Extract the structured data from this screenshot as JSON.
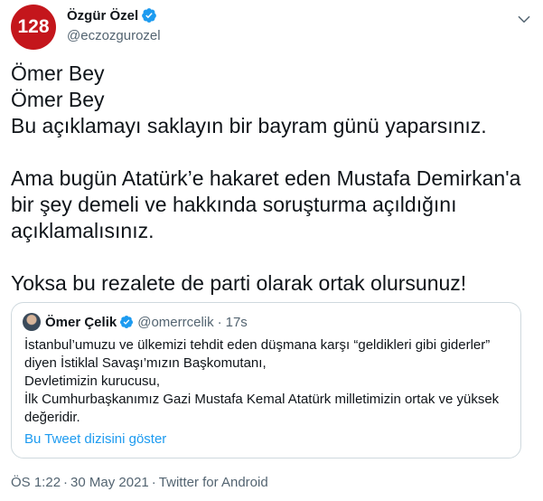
{
  "author": {
    "avatar_text": "128",
    "display_name": "Özgür Özel",
    "handle": "@eczozgurozel",
    "verified": true
  },
  "tweet": {
    "lines": [
      "Ömer Bey",
      "Ömer Bey",
      "Bu açıklamayı saklayın bir bayram günü yaparsınız.",
      "",
      "Ama bugün Atatürk’e hakaret eden Mustafa Demirkan'a",
      "bir şey demeli  ve hakkında soruşturma açıldığını",
      "açıklamalısınız.",
      "",
      "Yoksa bu rezalete de parti olarak ortak olursunuz!"
    ]
  },
  "quote": {
    "display_name": "Ömer Çelik",
    "handle": "@omerrcelik",
    "separator": "·",
    "time": "17s",
    "lines": [
      "İstanbul’umuzu ve ülkemizi  tehdit eden düşmana karşı “geldikleri gibi giderler”",
      "diyen İstiklal Savaşı’mızın Başkomutanı,",
      "Devletimizin kurucusu,",
      "İlk Cumhurbaşkanımız Gazi Mustafa Kemal Atatürk milletimizin ortak ve yüksek",
      "değeridir."
    ],
    "thread_link": "Bu Tweet dizisini göster"
  },
  "meta": {
    "time": "ÖS 1:22",
    "separator": "·",
    "date": "30 May 2021",
    "source": "Twitter for Android"
  },
  "colors": {
    "verified_blue": "#1d9bf0",
    "avatar_red": "#c4161c",
    "link_blue": "#1d9bf0",
    "secondary_text": "#536471"
  },
  "icons": {
    "verified": "verified-badge-icon",
    "more": "chevron-down-icon"
  }
}
